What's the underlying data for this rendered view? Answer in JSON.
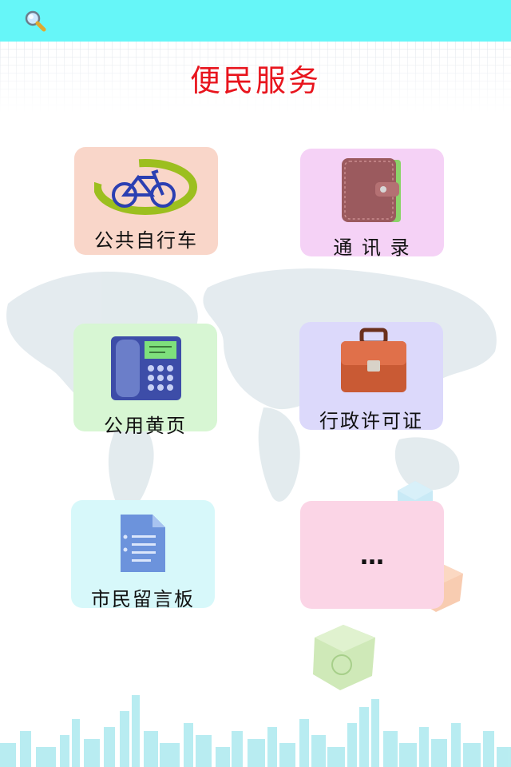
{
  "header": {
    "title": "便民服务"
  },
  "tiles": [
    {
      "label": "公共自行车",
      "color": "#f9d6c9"
    },
    {
      "label": "通 讯 录",
      "color": "#f5d2f6"
    },
    {
      "label": "公用黄页",
      "color": "#d7f6d3"
    },
    {
      "label": "行政许可证",
      "color": "#dcd9fb"
    },
    {
      "label": "市民留言板",
      "color": "#d7f8fa"
    },
    {
      "label": "…",
      "color": "#fbd5e6"
    }
  ],
  "colors": {
    "topbar": "#66f6f8",
    "title": "#e8141d"
  }
}
